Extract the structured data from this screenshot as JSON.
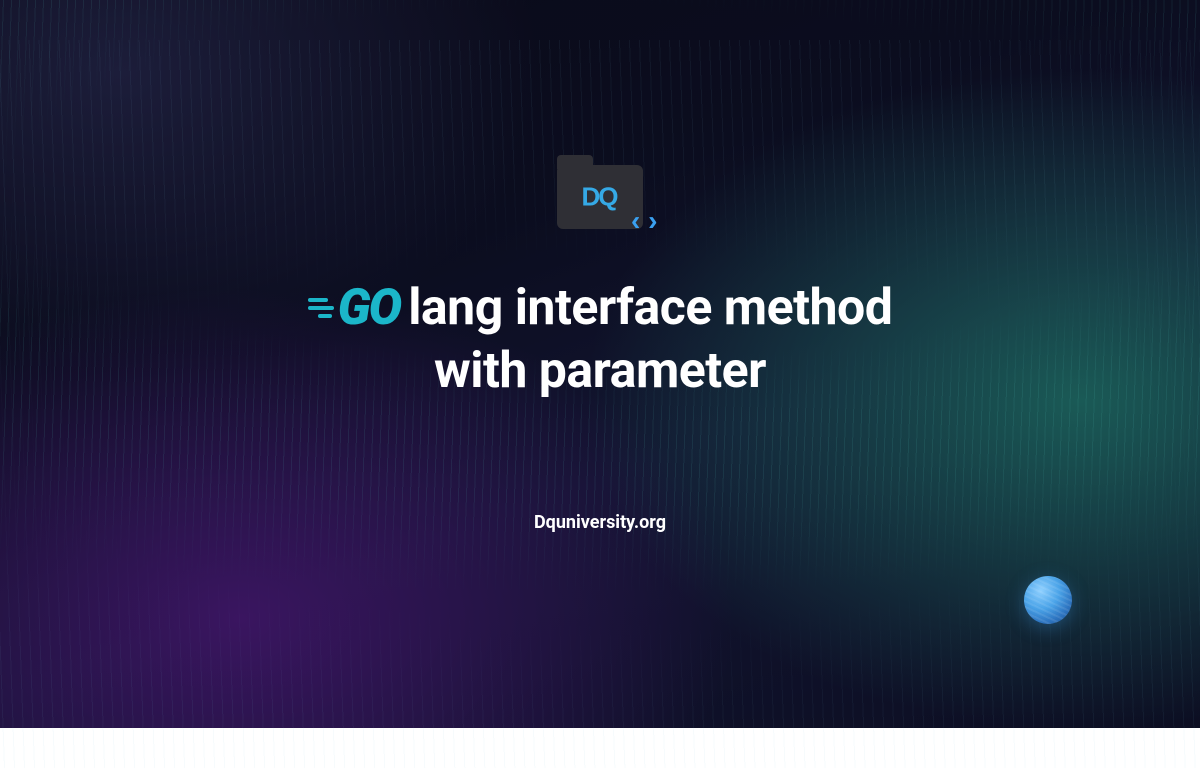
{
  "logo": {
    "folder_letters": "DQ",
    "code_glyph": "‹›"
  },
  "title": {
    "go_word": "GO",
    "line1_rest": "lang interface method",
    "line2": "with parameter"
  },
  "footer": {
    "site": "Dquniversity.org"
  },
  "colors": {
    "accent_go": "#1bb6c9",
    "accent_code": "#3aa0f0",
    "folder": "#2f2f35",
    "text": "#ffffff"
  }
}
